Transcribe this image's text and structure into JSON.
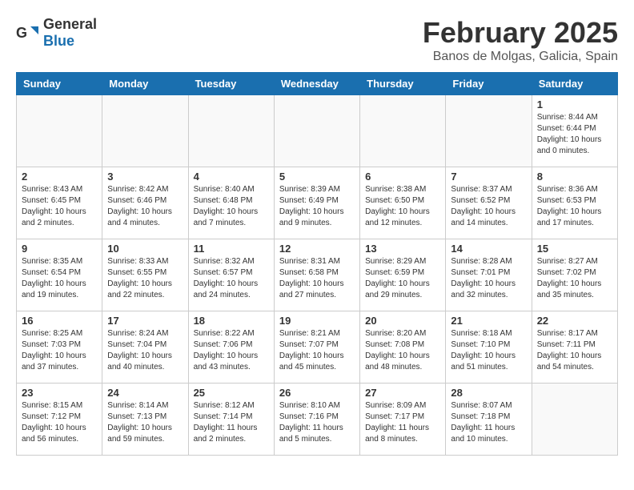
{
  "header": {
    "logo_general": "General",
    "logo_blue": "Blue",
    "title": "February 2025",
    "subtitle": "Banos de Molgas, Galicia, Spain"
  },
  "weekdays": [
    "Sunday",
    "Monday",
    "Tuesday",
    "Wednesday",
    "Thursday",
    "Friday",
    "Saturday"
  ],
  "weeks": [
    [
      {
        "day": "",
        "info": ""
      },
      {
        "day": "",
        "info": ""
      },
      {
        "day": "",
        "info": ""
      },
      {
        "day": "",
        "info": ""
      },
      {
        "day": "",
        "info": ""
      },
      {
        "day": "",
        "info": ""
      },
      {
        "day": "1",
        "info": "Sunrise: 8:44 AM\nSunset: 6:44 PM\nDaylight: 10 hours and 0 minutes."
      }
    ],
    [
      {
        "day": "2",
        "info": "Sunrise: 8:43 AM\nSunset: 6:45 PM\nDaylight: 10 hours and 2 minutes."
      },
      {
        "day": "3",
        "info": "Sunrise: 8:42 AM\nSunset: 6:46 PM\nDaylight: 10 hours and 4 minutes."
      },
      {
        "day": "4",
        "info": "Sunrise: 8:40 AM\nSunset: 6:48 PM\nDaylight: 10 hours and 7 minutes."
      },
      {
        "day": "5",
        "info": "Sunrise: 8:39 AM\nSunset: 6:49 PM\nDaylight: 10 hours and 9 minutes."
      },
      {
        "day": "6",
        "info": "Sunrise: 8:38 AM\nSunset: 6:50 PM\nDaylight: 10 hours and 12 minutes."
      },
      {
        "day": "7",
        "info": "Sunrise: 8:37 AM\nSunset: 6:52 PM\nDaylight: 10 hours and 14 minutes."
      },
      {
        "day": "8",
        "info": "Sunrise: 8:36 AM\nSunset: 6:53 PM\nDaylight: 10 hours and 17 minutes."
      }
    ],
    [
      {
        "day": "9",
        "info": "Sunrise: 8:35 AM\nSunset: 6:54 PM\nDaylight: 10 hours and 19 minutes."
      },
      {
        "day": "10",
        "info": "Sunrise: 8:33 AM\nSunset: 6:55 PM\nDaylight: 10 hours and 22 minutes."
      },
      {
        "day": "11",
        "info": "Sunrise: 8:32 AM\nSunset: 6:57 PM\nDaylight: 10 hours and 24 minutes."
      },
      {
        "day": "12",
        "info": "Sunrise: 8:31 AM\nSunset: 6:58 PM\nDaylight: 10 hours and 27 minutes."
      },
      {
        "day": "13",
        "info": "Sunrise: 8:29 AM\nSunset: 6:59 PM\nDaylight: 10 hours and 29 minutes."
      },
      {
        "day": "14",
        "info": "Sunrise: 8:28 AM\nSunset: 7:01 PM\nDaylight: 10 hours and 32 minutes."
      },
      {
        "day": "15",
        "info": "Sunrise: 8:27 AM\nSunset: 7:02 PM\nDaylight: 10 hours and 35 minutes."
      }
    ],
    [
      {
        "day": "16",
        "info": "Sunrise: 8:25 AM\nSunset: 7:03 PM\nDaylight: 10 hours and 37 minutes."
      },
      {
        "day": "17",
        "info": "Sunrise: 8:24 AM\nSunset: 7:04 PM\nDaylight: 10 hours and 40 minutes."
      },
      {
        "day": "18",
        "info": "Sunrise: 8:22 AM\nSunset: 7:06 PM\nDaylight: 10 hours and 43 minutes."
      },
      {
        "day": "19",
        "info": "Sunrise: 8:21 AM\nSunset: 7:07 PM\nDaylight: 10 hours and 45 minutes."
      },
      {
        "day": "20",
        "info": "Sunrise: 8:20 AM\nSunset: 7:08 PM\nDaylight: 10 hours and 48 minutes."
      },
      {
        "day": "21",
        "info": "Sunrise: 8:18 AM\nSunset: 7:10 PM\nDaylight: 10 hours and 51 minutes."
      },
      {
        "day": "22",
        "info": "Sunrise: 8:17 AM\nSunset: 7:11 PM\nDaylight: 10 hours and 54 minutes."
      }
    ],
    [
      {
        "day": "23",
        "info": "Sunrise: 8:15 AM\nSunset: 7:12 PM\nDaylight: 10 hours and 56 minutes."
      },
      {
        "day": "24",
        "info": "Sunrise: 8:14 AM\nSunset: 7:13 PM\nDaylight: 10 hours and 59 minutes."
      },
      {
        "day": "25",
        "info": "Sunrise: 8:12 AM\nSunset: 7:14 PM\nDaylight: 11 hours and 2 minutes."
      },
      {
        "day": "26",
        "info": "Sunrise: 8:10 AM\nSunset: 7:16 PM\nDaylight: 11 hours and 5 minutes."
      },
      {
        "day": "27",
        "info": "Sunrise: 8:09 AM\nSunset: 7:17 PM\nDaylight: 11 hours and 8 minutes."
      },
      {
        "day": "28",
        "info": "Sunrise: 8:07 AM\nSunset: 7:18 PM\nDaylight: 11 hours and 10 minutes."
      },
      {
        "day": "",
        "info": ""
      }
    ]
  ]
}
